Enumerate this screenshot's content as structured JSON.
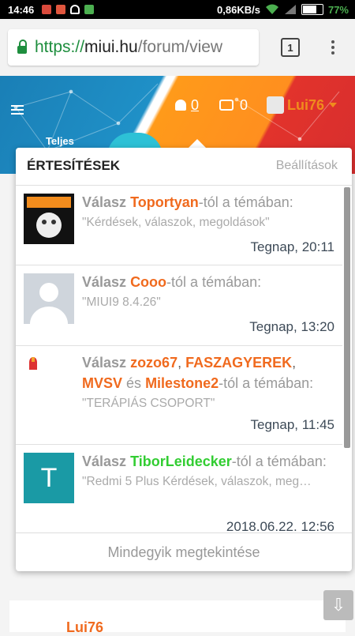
{
  "status_bar": {
    "time": "14:46",
    "speed": "0,86KB/s",
    "battery_level": 0.77,
    "battery_label": "77%",
    "icons": [
      "notification-icon",
      "mail-icon",
      "headset-icon",
      "file-icon",
      "wifi-icon",
      "signal-icon",
      "battery-icon"
    ]
  },
  "browser": {
    "url_scheme": "https://",
    "url_host": "miui.hu",
    "url_path": "/forum/view",
    "tab_count": "1"
  },
  "header": {
    "site_text": "Teljes",
    "notification_count": "0",
    "inbox_count": "0",
    "username": "Lui76"
  },
  "notifications_panel": {
    "title": "ÉRTESÍTÉSEK",
    "settings_label": "Beállítások",
    "view_all_label": "Mindegyik megtekintése",
    "items": [
      {
        "prefix": "Válasz",
        "users": [
          "Toportyan"
        ],
        "user_colors": [
          "#f06a1e"
        ],
        "suffix": "-tól a témában:",
        "thread": "\"Kérdések, válaszok, megoldások\"",
        "time": "Tegnap, 20:11"
      },
      {
        "prefix": "Válasz",
        "users": [
          "Cooo"
        ],
        "user_colors": [
          "#f06a1e"
        ],
        "suffix": "-tól a témában:",
        "thread": "\"MIUI9 8.4.26\"",
        "time": "Tegnap, 13:20"
      },
      {
        "prefix": "Válasz",
        "users": [
          "zozo67",
          "FASZAGYEREK",
          "MVSV",
          "Milestone2"
        ],
        "user_colors": [
          "#f06a1e",
          "#f06a1e",
          "#f06a1e",
          "#f06a1e"
        ],
        "conjunction": "és",
        "suffix": "-tól a témában:",
        "thread": "\"TERÁPIÁS CSOPORT\"",
        "time": "Tegnap, 11:45"
      },
      {
        "prefix": "Válasz",
        "users": [
          "TiborLeidecker"
        ],
        "user_colors": [
          "#32cd32"
        ],
        "suffix": "-tól a témában:",
        "thread": "\"Redmi 5 Plus Kérdések, válaszok, meg…",
        "time": "2018.06.22. 12:56",
        "avatar_letter": "T"
      }
    ]
  },
  "background": {
    "post_username": "Lui76"
  },
  "colors": {
    "accent": "#f06a1e",
    "header_blue": "#1f90c7",
    "header_orange": "#ff9a1a",
    "header_red": "#d72e2e",
    "avatar_teal": "#1a9aa5"
  }
}
